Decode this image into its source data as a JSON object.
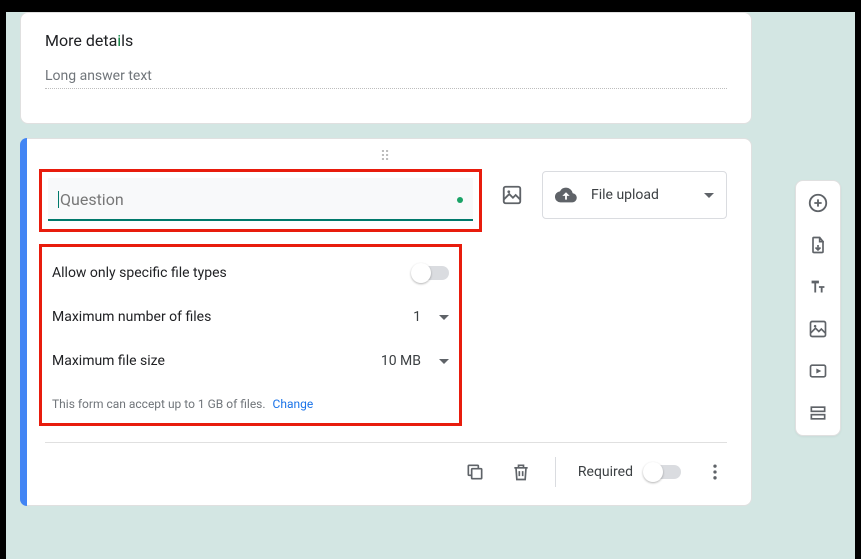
{
  "topCard": {
    "title_prefix": "More deta",
    "title_i": "i",
    "title_suffix": "ls",
    "longAnswerPlaceholder": "Long answer text"
  },
  "question": {
    "placeholder": "Question"
  },
  "typeSelect": {
    "label": "File upload"
  },
  "options": {
    "allowSpecific": {
      "label": "Allow only specific file types"
    },
    "maxFiles": {
      "label": "Maximum number of files",
      "value": "1"
    },
    "maxSize": {
      "label": "Maximum file size",
      "value": "10 MB"
    },
    "hint": "This form can accept up to 1 GB of files.",
    "changeLabel": "Change"
  },
  "footer": {
    "requiredLabel": "Required"
  }
}
